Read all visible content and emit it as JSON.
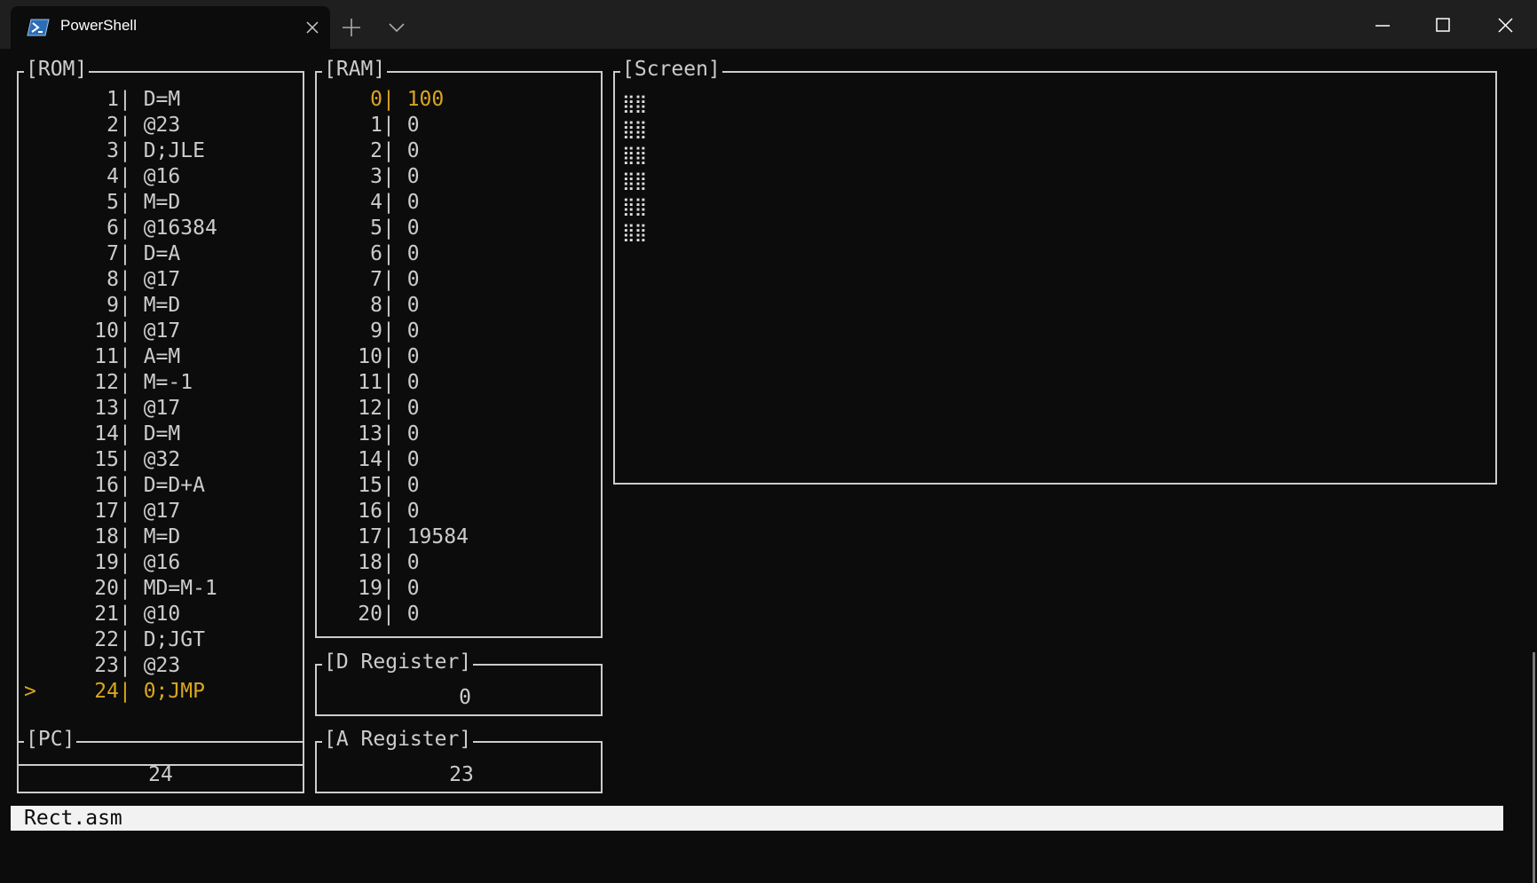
{
  "window": {
    "tab_title": "PowerShell"
  },
  "rom": {
    "title": "[ROM]",
    "rows": [
      {
        "ptr": "",
        "num": "1",
        "text": "D=M"
      },
      {
        "ptr": "",
        "num": "2",
        "text": "@23"
      },
      {
        "ptr": "",
        "num": "3",
        "text": "D;JLE"
      },
      {
        "ptr": "",
        "num": "4",
        "text": "@16"
      },
      {
        "ptr": "",
        "num": "5",
        "text": "M=D"
      },
      {
        "ptr": "",
        "num": "6",
        "text": "@16384"
      },
      {
        "ptr": "",
        "num": "7",
        "text": "D=A"
      },
      {
        "ptr": "",
        "num": "8",
        "text": "@17"
      },
      {
        "ptr": "",
        "num": "9",
        "text": "M=D"
      },
      {
        "ptr": "",
        "num": "10",
        "text": "@17"
      },
      {
        "ptr": "",
        "num": "11",
        "text": "A=M"
      },
      {
        "ptr": "",
        "num": "12",
        "text": "M=-1"
      },
      {
        "ptr": "",
        "num": "13",
        "text": "@17"
      },
      {
        "ptr": "",
        "num": "14",
        "text": "D=M"
      },
      {
        "ptr": "",
        "num": "15",
        "text": "@32"
      },
      {
        "ptr": "",
        "num": "16",
        "text": "D=D+A"
      },
      {
        "ptr": "",
        "num": "17",
        "text": "@17"
      },
      {
        "ptr": "",
        "num": "18",
        "text": "M=D"
      },
      {
        "ptr": "",
        "num": "19",
        "text": "@16"
      },
      {
        "ptr": "",
        "num": "20",
        "text": "MD=M-1"
      },
      {
        "ptr": "",
        "num": "21",
        "text": "@10"
      },
      {
        "ptr": "",
        "num": "22",
        "text": "D;JGT"
      },
      {
        "ptr": "",
        "num": "23",
        "text": "@23"
      },
      {
        "ptr": ">",
        "num": "24",
        "text": "0;JMP"
      }
    ],
    "active_index": 23
  },
  "ram": {
    "title": "[RAM]",
    "rows": [
      {
        "num": "0",
        "text": "100"
      },
      {
        "num": "1",
        "text": "0"
      },
      {
        "num": "2",
        "text": "0"
      },
      {
        "num": "3",
        "text": "0"
      },
      {
        "num": "4",
        "text": "0"
      },
      {
        "num": "5",
        "text": "0"
      },
      {
        "num": "6",
        "text": "0"
      },
      {
        "num": "7",
        "text": "0"
      },
      {
        "num": "8",
        "text": "0"
      },
      {
        "num": "9",
        "text": "0"
      },
      {
        "num": "10",
        "text": "0"
      },
      {
        "num": "11",
        "text": "0"
      },
      {
        "num": "12",
        "text": "0"
      },
      {
        "num": "13",
        "text": "0"
      },
      {
        "num": "14",
        "text": "0"
      },
      {
        "num": "15",
        "text": "0"
      },
      {
        "num": "16",
        "text": "0"
      },
      {
        "num": "17",
        "text": "19584"
      },
      {
        "num": "18",
        "text": "0"
      },
      {
        "num": "19",
        "text": "0"
      },
      {
        "num": "20",
        "text": "0"
      }
    ],
    "active_index": 0
  },
  "screen": {
    "title": "[Screen]",
    "rows": [
      "⣿⣿",
      "⣿⣿",
      "⣿⣿",
      "⣿⣿",
      "⣿⣿",
      "⣿⣿"
    ]
  },
  "pc": {
    "title": "[PC]",
    "value": "24"
  },
  "d_register": {
    "title": "[D Register]",
    "value": "0"
  },
  "a_register": {
    "title": "[A Register]",
    "value": "23"
  },
  "status": {
    "filename": "Rect.asm"
  },
  "colors": {
    "active": "#d9a521",
    "fg": "#cccccc",
    "bg": "#0c0c0c"
  }
}
